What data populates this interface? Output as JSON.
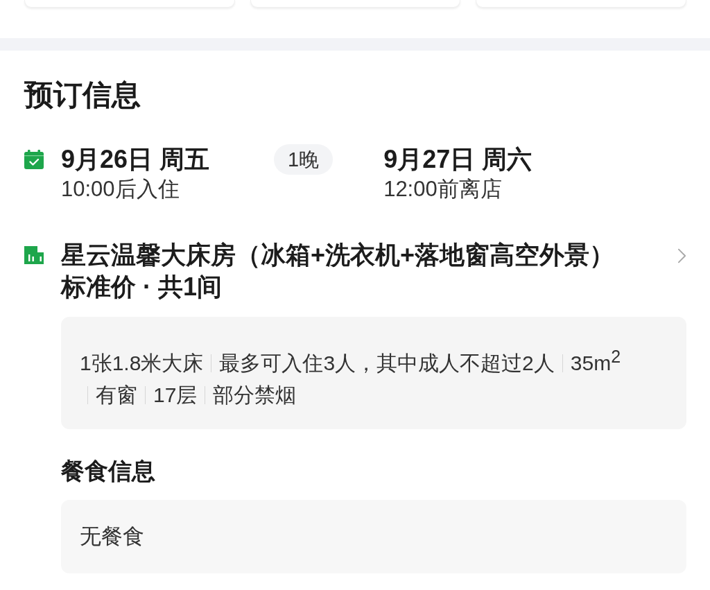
{
  "section": {
    "title": "预订信息"
  },
  "stay": {
    "check_in": {
      "date": "9月26日 周五",
      "time": "10:00后入住"
    },
    "nights": "1晚",
    "check_out": {
      "date": "9月27日 周六",
      "time": "12:00前离店"
    }
  },
  "room": {
    "name": "星云温馨大床房（冰箱+洗衣机+落地窗高空外景）",
    "subtitle": "标准价 · 共1间",
    "facilities": [
      "1张1.8米大床",
      "最多可入住3人，其中成人不超过2人",
      "35m$^{2}$",
      "有窗",
      "17层",
      "部分禁烟"
    ]
  },
  "meals": {
    "title": "餐食信息",
    "value": "无餐食"
  }
}
